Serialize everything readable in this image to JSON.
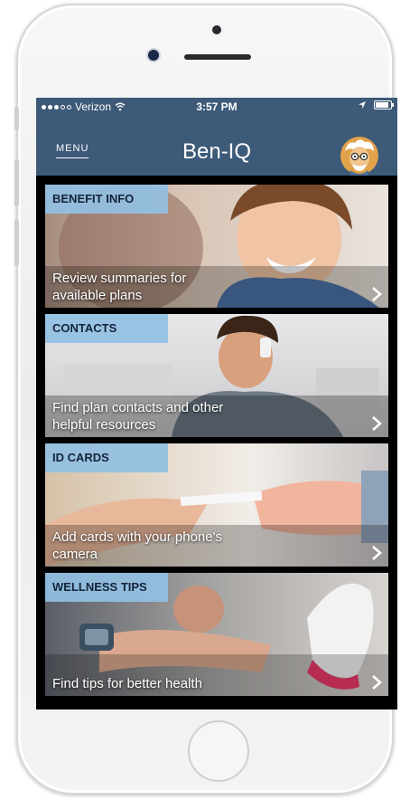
{
  "status_bar": {
    "carrier": "Verizon",
    "time": "3:57 PM"
  },
  "nav": {
    "menu_label": "MENU",
    "title": "Ben-IQ"
  },
  "tiles": [
    {
      "tag": "BENEFIT INFO",
      "line1": "Review summaries for",
      "line2": "available plans"
    },
    {
      "tag": "CONTACTS",
      "line1": "Find plan contacts and other",
      "line2": "helpful resources"
    },
    {
      "tag": "ID CARDS",
      "line1": "Add cards with your phone's",
      "line2": "camera"
    },
    {
      "tag": "WELLNESS TIPS",
      "line1": "Find tips for better health",
      "line2": ""
    }
  ],
  "colors": {
    "nav_bg": "#3d5a78",
    "tag_bg": "#92c0e3",
    "screen_bg": "#000000"
  },
  "icons": [
    "wifi-icon",
    "location-arrow-icon",
    "battery-icon",
    "professor-avatar-icon",
    "chevron-right-icon"
  ]
}
